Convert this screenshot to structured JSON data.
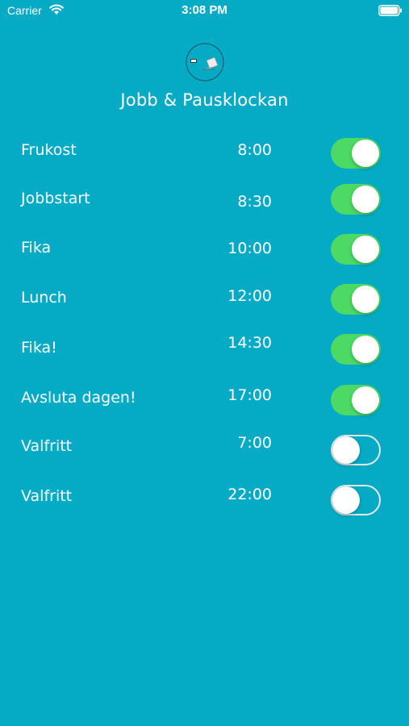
{
  "status_bar": {
    "carrier": "Carrier",
    "time": "3:08 PM",
    "wifi_icon": "wifi-icon",
    "battery_icon": "battery-icon"
  },
  "app": {
    "title": "Jobb & Pausklockan",
    "logo_icon": "desk-laptop-logo"
  },
  "colors": {
    "background": "#05abc4",
    "toggle_on": "#4cd964",
    "toggle_off_border": "#e6e6e6"
  },
  "alarms": [
    {
      "label": "Frukost",
      "time": "8:00",
      "enabled": true
    },
    {
      "label": "Jobbstart",
      "time": "8:30",
      "enabled": true
    },
    {
      "label": "Fika",
      "time": "10:00",
      "enabled": true
    },
    {
      "label": "Lunch",
      "time": "12:00",
      "enabled": true
    },
    {
      "label": "Fika!",
      "time": "14:30",
      "enabled": true
    },
    {
      "label": "Avsluta dagen!",
      "time": "17:00",
      "enabled": true
    },
    {
      "label": "Valfritt",
      "time": "7:00",
      "enabled": false
    },
    {
      "label": "Valfritt",
      "time": "22:00",
      "enabled": false
    }
  ]
}
